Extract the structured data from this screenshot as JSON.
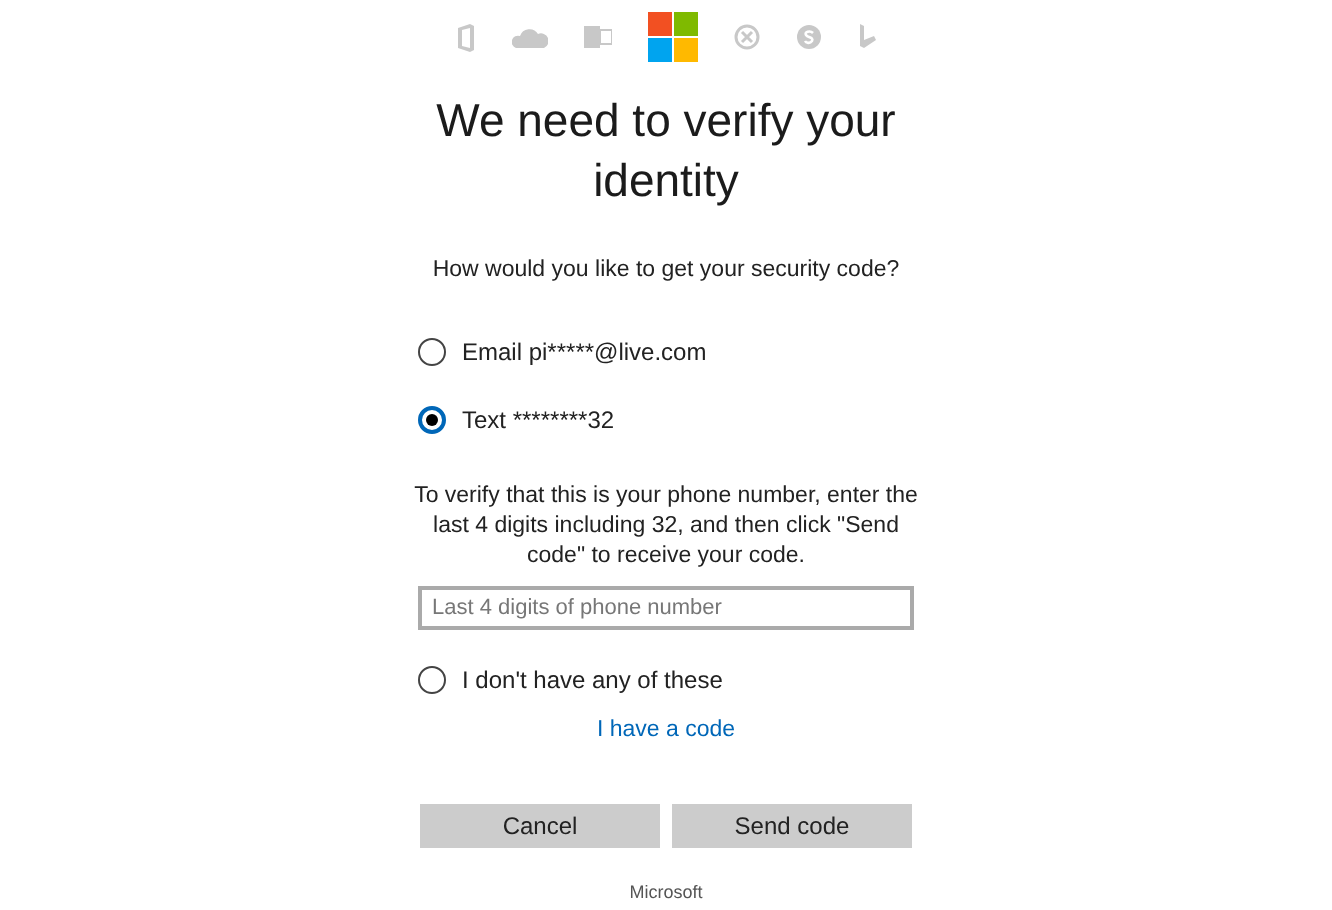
{
  "title": "We need to verify your identity",
  "question": "How would you like to get your security code?",
  "options": [
    {
      "label": "Email pi*****@live.com",
      "selected": false
    },
    {
      "label": "Text ********32",
      "selected": true
    }
  ],
  "instructions": "To verify that this is your phone number, enter the last 4 digits including 32, and then click \"Send code\" to receive your code.",
  "phone_field": {
    "placeholder": "Last 4 digits of phone number"
  },
  "no_access_option": {
    "label": "I don't have any of these",
    "selected": false
  },
  "link": "I have a code",
  "buttons": [
    "Cancel",
    "Send code"
  ],
  "footer": "Microsoft"
}
